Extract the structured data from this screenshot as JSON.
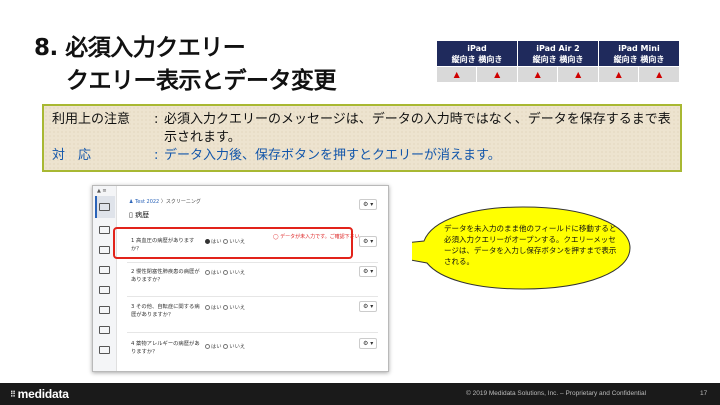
{
  "slide": {
    "title_line1": "8.  必須入力クエリー",
    "title_line2": "クエリー表示とデータ変更",
    "page_number": "17",
    "copyright": "© 2019 Medidata Solutions, Inc. – Proprietary and Confidential",
    "logo_text": "medidata"
  },
  "devices": [
    {
      "name": "iPad",
      "sub": "縦向き  横向き",
      "marks": [
        "▲",
        "▲"
      ]
    },
    {
      "name": "iPad Air 2",
      "sub": "縦向き  横向き",
      "marks": [
        "▲",
        "▲"
      ]
    },
    {
      "name": "iPad Mini",
      "sub": "縦向き  横向き",
      "marks": [
        "▲",
        "▲"
      ]
    }
  ],
  "notice": {
    "label1": "利用上の注意",
    "sep": ":",
    "text1": "必須入力クエリーのメッセージは、データの入力時ではなく、データを保存するまで表示されます。",
    "label2": "対　応",
    "text2": "データ入力後、保存ボタンを押すとクエリーが消えます。"
  },
  "app": {
    "breadcrumb_study": "Test 2022",
    "breadcrumb_rest": "〉スクリーニング",
    "page_title": "病歴",
    "gear_label": "⚙ ▾",
    "query_message": "◯ データが未入力です。ご確認下さい。",
    "questions": [
      {
        "label": "1  高血圧の病歴がありますか？",
        "yes": "はい",
        "no": "いいえ",
        "selected": "yes"
      },
      {
        "label": "2  慢性閉塞性肺疾患の病歴がありますか？",
        "yes": "はい",
        "no": "いいえ",
        "selected": ""
      },
      {
        "label": "3  その他、自転症に関する病歴がありますか？",
        "yes": "はい",
        "no": "いいえ",
        "selected": ""
      },
      {
        "label": "4  薬物アレルギーの病歴がありますか？",
        "yes": "はい",
        "no": "いいえ",
        "selected": ""
      }
    ]
  },
  "callout": {
    "text": "データを未入力のまま他のフィールドに移動すると必須入力クエリーがオープンする。クエリーメッセージは、データを入力し保存ボタンを押すまで表示される。"
  },
  "colors": {
    "header_navy": "#1f2a5c",
    "warning_red": "#d00000",
    "highlight_red": "#e2231a",
    "callout_yellow": "#ffff00",
    "notice_border": "#a8b832",
    "notice_blue": "#1155aa"
  }
}
